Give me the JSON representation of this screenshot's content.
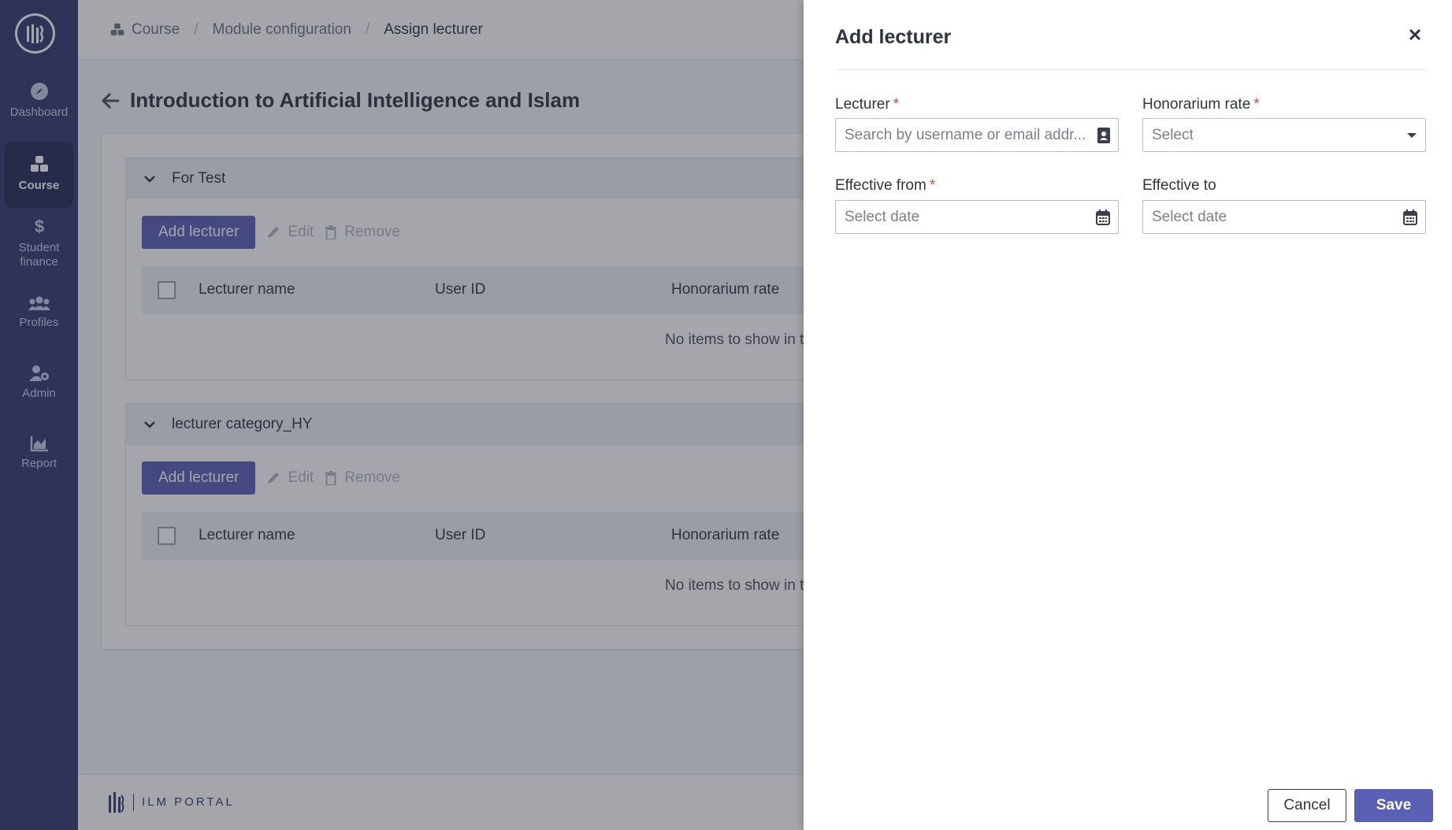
{
  "sidebar": {
    "items": [
      {
        "label": "Dashboard",
        "icon": "compass-icon"
      },
      {
        "label": "Course",
        "icon": "cubes-icon",
        "active": true
      },
      {
        "label": "Student finance",
        "icon": "dollar-icon"
      },
      {
        "label": "Profiles",
        "icon": "users-icon"
      },
      {
        "label": "Admin",
        "icon": "user-cog-icon"
      },
      {
        "label": "Report",
        "icon": "chart-area-icon"
      }
    ]
  },
  "breadcrumb": {
    "items": [
      "Course",
      "Module configuration",
      "Assign lecturer"
    ]
  },
  "page": {
    "title": "Introduction to Artificial Intelligence and Islam"
  },
  "sections": [
    {
      "title": "For Test",
      "add_label": "Add lecturer",
      "edit_label": "Edit",
      "remove_label": "Remove",
      "columns": [
        "Lecturer name",
        "User ID",
        "Honorarium rate"
      ],
      "empty_message": "No items to show in t"
    },
    {
      "title": "lecturer category_HY",
      "add_label": "Add lecturer",
      "edit_label": "Edit",
      "remove_label": "Remove",
      "columns": [
        "Lecturer name",
        "User ID",
        "Honorarium rate"
      ],
      "empty_message": "No items to show in t"
    }
  ],
  "footer": {
    "brand": "ILM PORTAL"
  },
  "drawer": {
    "title": "Add lecturer",
    "fields": {
      "lecturer": {
        "label": "Lecturer",
        "required_mark": "*",
        "placeholder": "Search by username or email addr..."
      },
      "honorarium_rate": {
        "label": "Honorarium rate",
        "required_mark": "*",
        "placeholder": "Select"
      },
      "effective_from": {
        "label": "Effective from",
        "required_mark": "*",
        "placeholder": "Select date"
      },
      "effective_to": {
        "label": "Effective to",
        "placeholder": "Select date"
      }
    },
    "cancel_label": "Cancel",
    "save_label": "Save"
  },
  "colors": {
    "sidebar": "#343a6d",
    "primary": "#5a60b4",
    "required": "#d64545"
  }
}
